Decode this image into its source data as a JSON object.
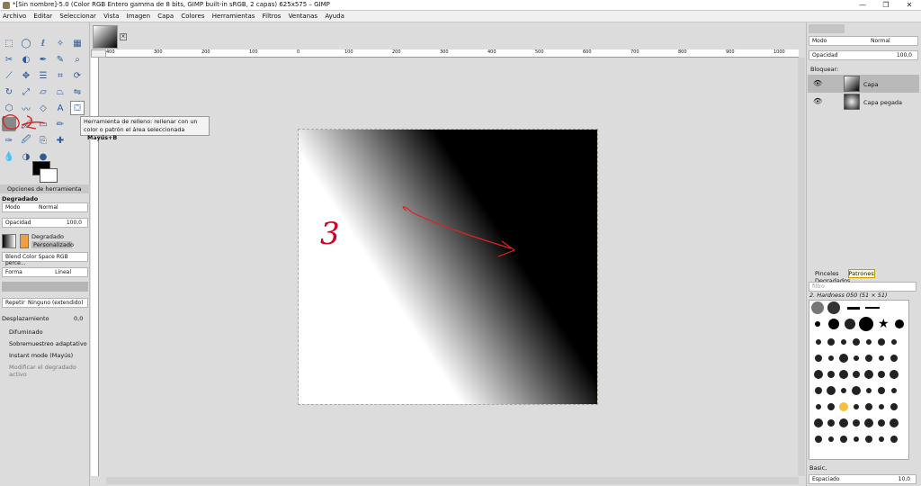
{
  "window": {
    "title": "*[Sin nombre]-5.0 (Color RGB Entero gamma de 8 bits, GIMP built-in sRGB, 2 capas) 625x575 – GIMP"
  },
  "menu": [
    "Archivo",
    "Editar",
    "Seleccionar",
    "Vista",
    "Imagen",
    "Capa",
    "Colores",
    "Herramientas",
    "Filtros",
    "Ventanas",
    "Ayuda"
  ],
  "tooltip": {
    "text": "Herramienta de relleno: rellenar con un color o patrón el área seleccionada",
    "shortcut": "Mayús+B"
  },
  "tool_options": {
    "tab": "Opciones de herramienta",
    "tool_name": "Degradado",
    "mode_label": "Modo",
    "mode_value": "Normal",
    "opacity_label": "Opacidad",
    "opacity_value": "100,0",
    "gradient_label": "Degradado",
    "gradient_value": "Personalizado",
    "blend_space": "Blend Color Space RGB perce...",
    "shape_label": "Forma",
    "shape_value": "Lineal",
    "repeat_label": "Repetir",
    "repeat_value": "Ninguno (extendido)",
    "offset_label": "Desplazamiento",
    "offset_value": "0,0",
    "dither": "Difuminado",
    "supersample": "Sobremuestreo adaptativo",
    "instant": "Instant mode  (Mayús)",
    "modify": "Modificar el degradado activo"
  },
  "ruler_labels": [
    "400",
    "300",
    "200",
    "100",
    "0",
    "100",
    "200",
    "300",
    "400",
    "500",
    "600",
    "700",
    "800",
    "900",
    "1000"
  ],
  "layers_panel": {
    "mode_label": "Modo",
    "mode_value": "Normal",
    "opacity_label": "Opacidad",
    "opacity_value": "100,0",
    "lock_label": "Bloquear:",
    "layers": [
      "Capa",
      "Capa pegada"
    ]
  },
  "brushes_panel": {
    "tabs": [
      "Pinceles",
      "Patrones",
      "Degradados"
    ],
    "filter_placeholder": "filtro",
    "brush_name": "2. Hardness 050 (51 × 51)",
    "preset": "Basic,",
    "spacing_label": "Espaciado",
    "spacing_value": "10,0"
  },
  "annotation": {
    "text": "3"
  }
}
